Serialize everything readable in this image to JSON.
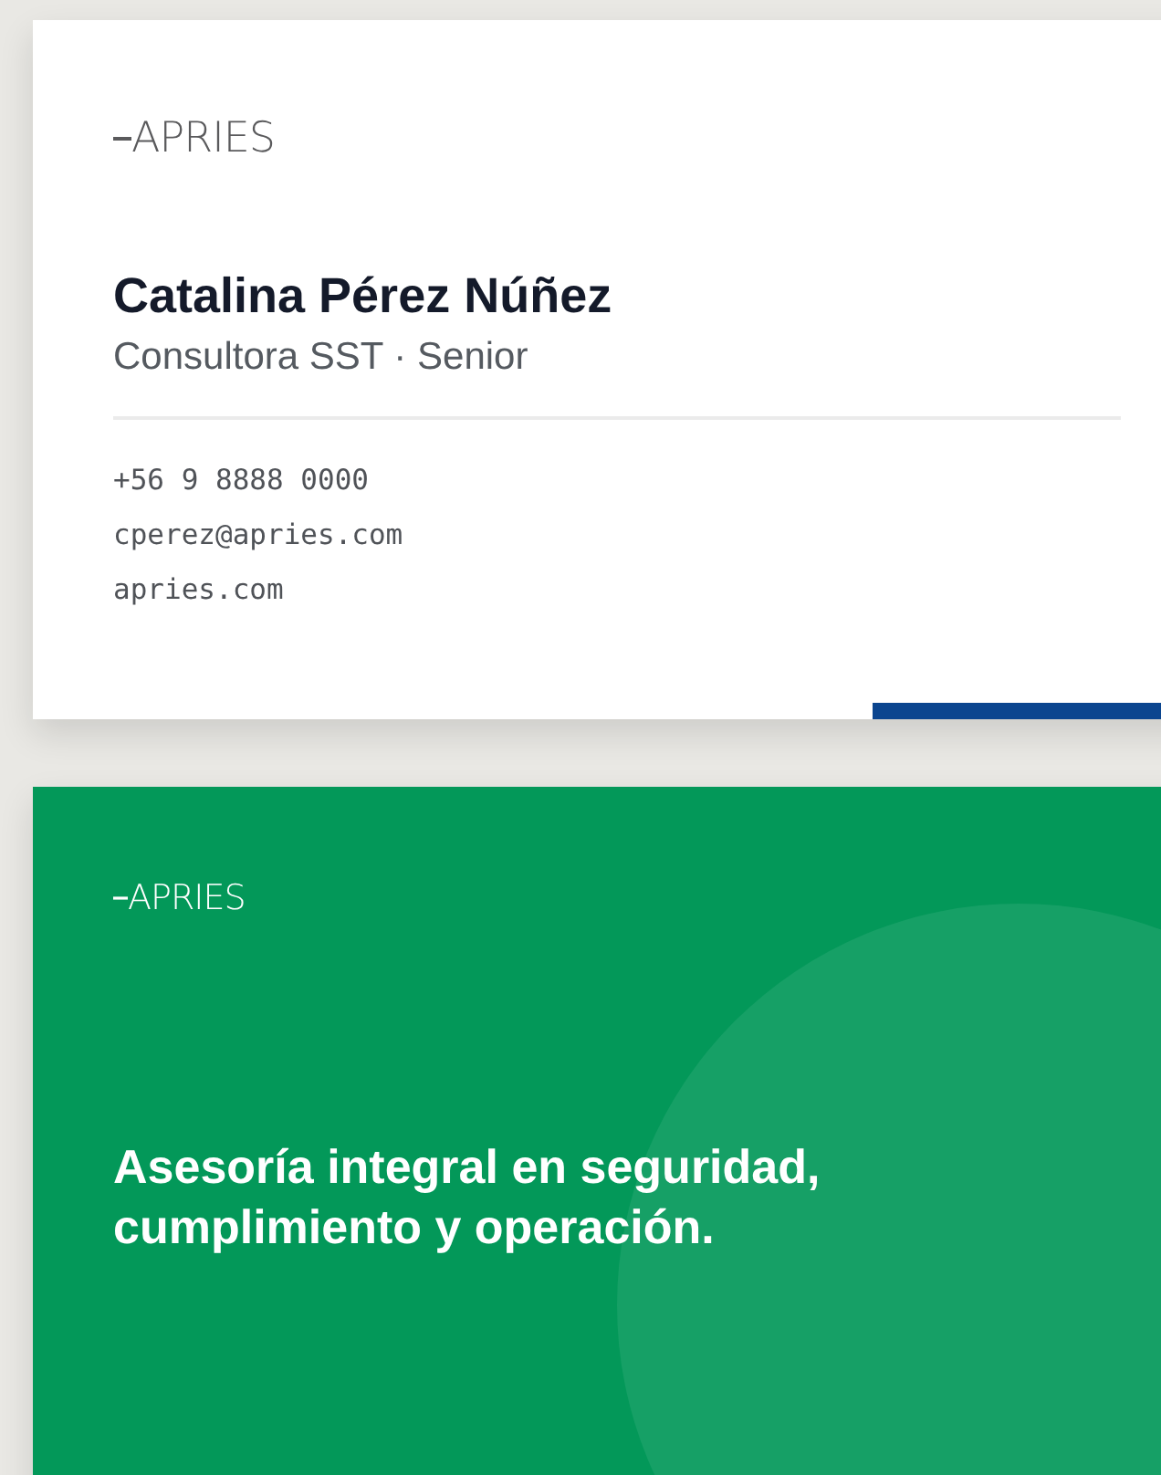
{
  "front_card": {
    "logo": "APRIES",
    "name": "Catalina Pérez Núñez",
    "role": "Consultora SST · Senior",
    "contacts": [
      "+56 9 8888 0000",
      "cperez@apries.com",
      "apries.com"
    ]
  },
  "back_card": {
    "logo": "APRIES",
    "tagline": "Asesoría integral en seguridad, cumplimiento y operación."
  }
}
